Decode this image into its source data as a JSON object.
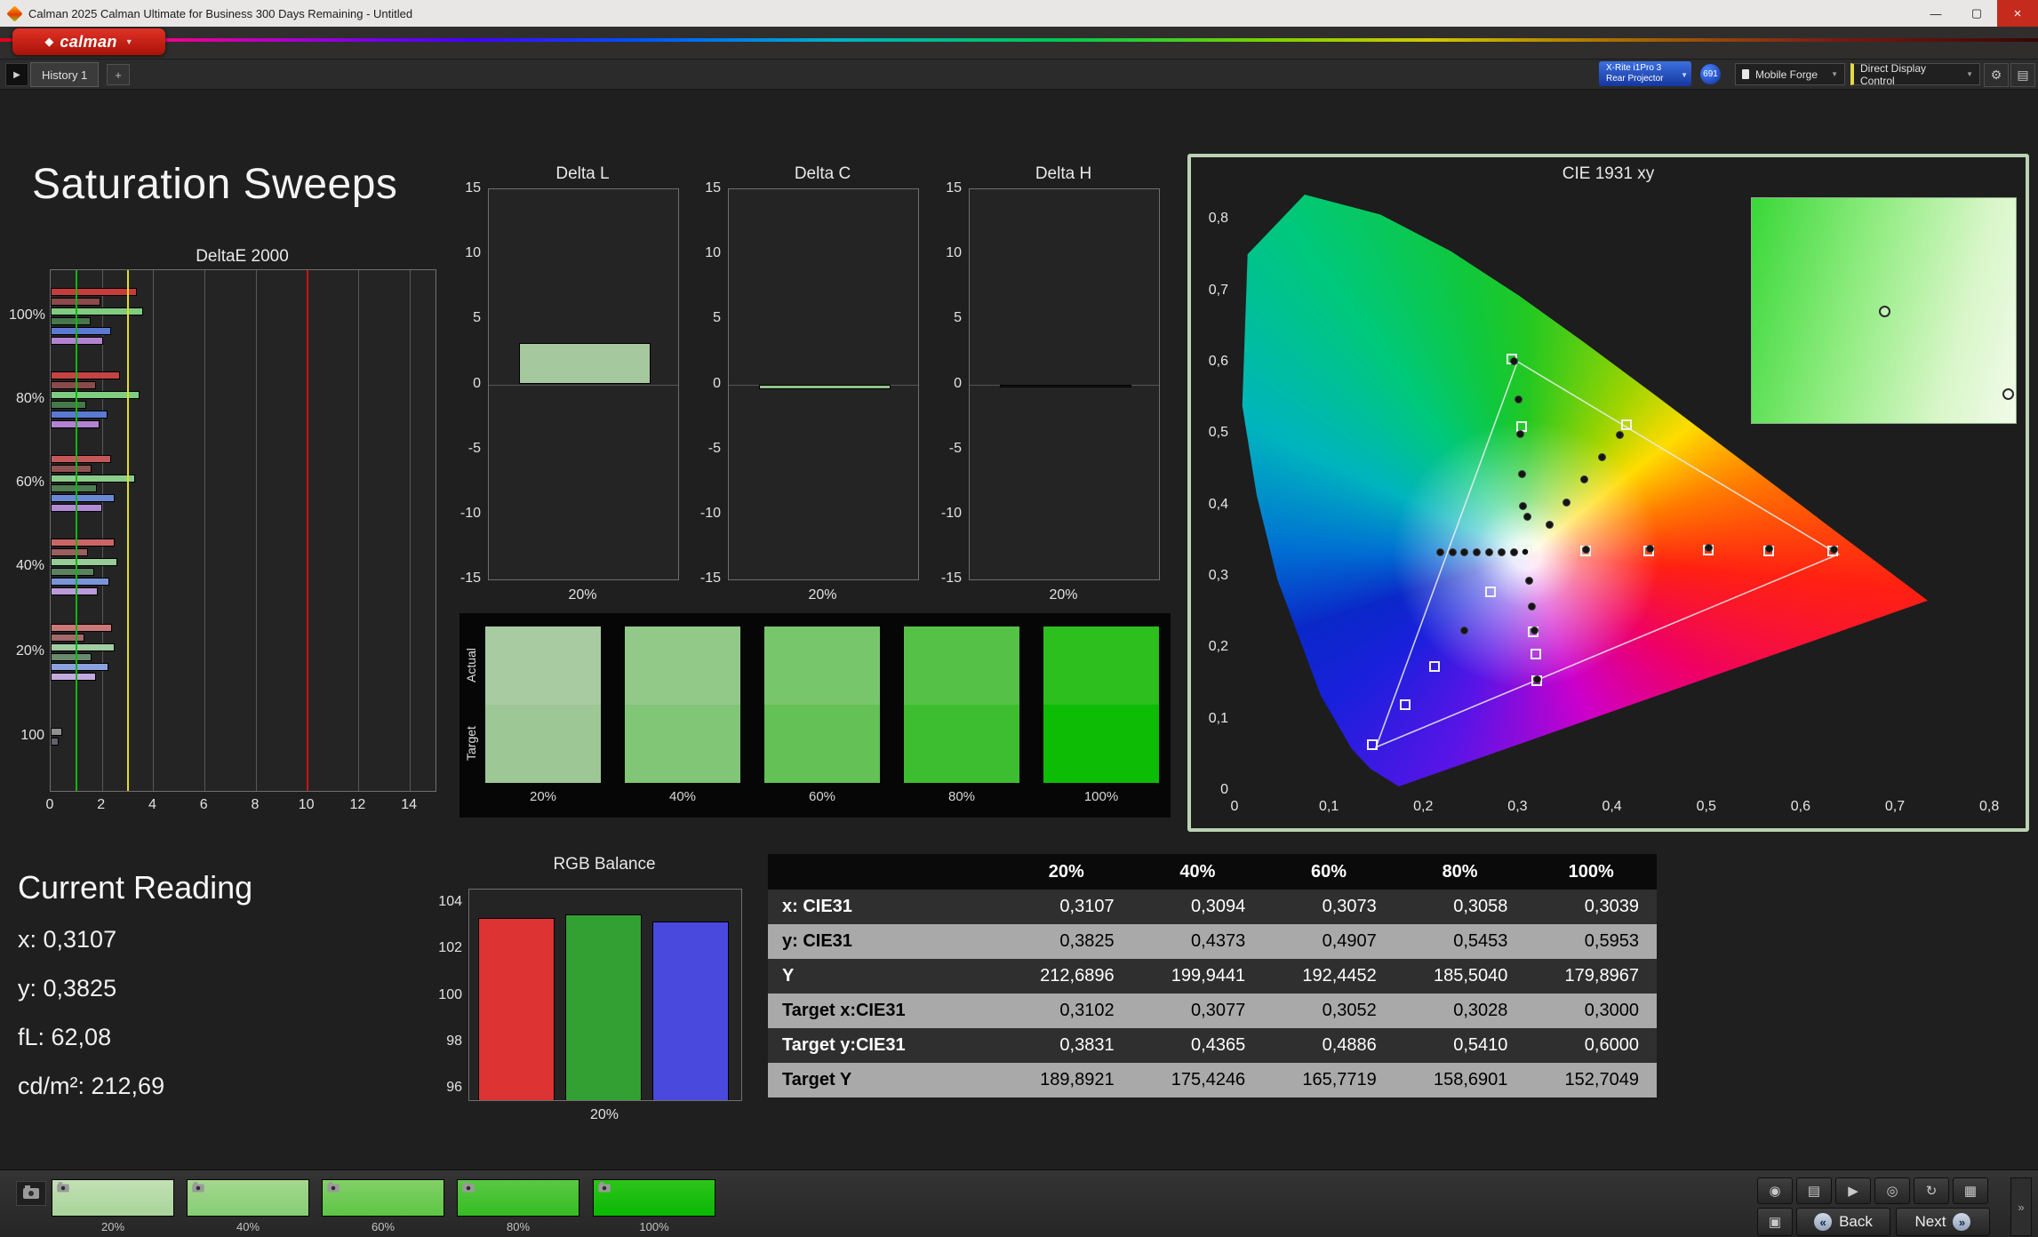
{
  "window": {
    "title": "Calman 2025 Calman Ultimate for Business 300 Days Remaining  - Untitled"
  },
  "brand": {
    "logo_text": "calman"
  },
  "icons": {
    "app": "◆",
    "logo_mark": "◆",
    "caret_down": "▼",
    "minimize": "—",
    "maximize": "▢",
    "close": "×",
    "history_arrow": "▶",
    "add": "+",
    "gear": "⚙",
    "layout": "▤",
    "monitor": "▣",
    "back_chevrons": "«",
    "next_chevrons": "»",
    "side_chevron": "»"
  },
  "toolbar": {
    "history_tab": "History 1",
    "meter": {
      "line1": "X-Rite i1Pro 3",
      "line2": "Rear Projector"
    },
    "badge": "691",
    "source": "Mobile Forge",
    "display_control": "Direct Display Control"
  },
  "page_title": "Saturation Sweeps",
  "current_reading": {
    "title": "Current Reading",
    "lines": [
      "x: 0,3107",
      "y: 0,3825",
      "fL: 62,08",
      "cd/m²: 212,69"
    ]
  },
  "chart_data": [
    {
      "id": "deltae2000",
      "type": "bar",
      "orientation": "horizontal",
      "title": "DeltaE 2000",
      "xlim": [
        0,
        15
      ],
      "x_ticks": [
        0,
        2,
        4,
        6,
        8,
        10,
        12,
        14
      ],
      "reference_lines": [
        {
          "value": 1,
          "color": "#12b412"
        },
        {
          "value": 3,
          "color": "#e0e020"
        },
        {
          "value": 10,
          "color": "#cc1414"
        }
      ],
      "groups": [
        {
          "label": "100%",
          "bars": [
            {
              "v": 3.35,
              "c": "#c43c3c"
            },
            {
              "v": 1.95,
              "c": "#8a4a4a"
            },
            {
              "v": 3.6,
              "c": "#80cc80"
            },
            {
              "v": 1.55,
              "c": "#46784a"
            },
            {
              "v": 2.35,
              "c": "#5a7ad2"
            },
            {
              "v": 2.05,
              "c": "#b482d2"
            }
          ]
        },
        {
          "label": "80%",
          "bars": [
            {
              "v": 2.7,
              "c": "#c44444"
            },
            {
              "v": 1.75,
              "c": "#8a4a4a"
            },
            {
              "v": 3.45,
              "c": "#80cc80"
            },
            {
              "v": 1.4,
              "c": "#46784a"
            },
            {
              "v": 2.2,
              "c": "#5a7ad2"
            },
            {
              "v": 1.9,
              "c": "#b482d2"
            }
          ]
        },
        {
          "label": "60%",
          "bars": [
            {
              "v": 2.35,
              "c": "#c45858"
            },
            {
              "v": 1.6,
              "c": "#925252"
            },
            {
              "v": 3.3,
              "c": "#8acc8a"
            },
            {
              "v": 1.8,
              "c": "#4e7e52"
            },
            {
              "v": 2.5,
              "c": "#6a88d6"
            },
            {
              "v": 2.0,
              "c": "#b48ad6"
            }
          ]
        },
        {
          "label": "40%",
          "bars": [
            {
              "v": 2.5,
              "c": "#cc6666"
            },
            {
              "v": 1.45,
              "c": "#9a5e5e"
            },
            {
              "v": 2.6,
              "c": "#96cc96"
            },
            {
              "v": 1.7,
              "c": "#5a825e"
            },
            {
              "v": 2.3,
              "c": "#7a94da"
            },
            {
              "v": 1.85,
              "c": "#bc9ada"
            }
          ]
        },
        {
          "label": "20%",
          "bars": [
            {
              "v": 2.4,
              "c": "#cc7878"
            },
            {
              "v": 1.3,
              "c": "#a26a6a"
            },
            {
              "v": 2.5,
              "c": "#a2cca2"
            },
            {
              "v": 1.6,
              "c": "#6a8a6e"
            },
            {
              "v": 2.25,
              "c": "#8aa2de"
            },
            {
              "v": 1.75,
              "c": "#c2aade"
            }
          ]
        },
        {
          "label": "100",
          "bars": [
            {
              "v": 0.45,
              "c": "#909090"
            },
            {
              "v": 0.3,
              "c": "#606070"
            }
          ]
        }
      ]
    },
    {
      "id": "delta_l",
      "type": "bar",
      "title": "Delta L",
      "ylim": [
        -15,
        15
      ],
      "y_ticks": [
        15,
        10,
        5,
        0,
        -5,
        -10,
        -15
      ],
      "categories": [
        "20%"
      ],
      "values": [
        3.15
      ],
      "bar_color": "#a6c89e"
    },
    {
      "id": "delta_c",
      "type": "bar",
      "title": "Delta C",
      "ylim": [
        -15,
        15
      ],
      "y_ticks": [
        15,
        10,
        5,
        0,
        -5,
        -10,
        -15
      ],
      "categories": [
        "20%"
      ],
      "values": [
        -0.4
      ],
      "bar_color": "#8fc287"
    },
    {
      "id": "delta_h",
      "type": "bar",
      "title": "Delta H",
      "ylim": [
        -15,
        15
      ],
      "y_ticks": [
        15,
        10,
        5,
        0,
        -5,
        -10,
        -15
      ],
      "categories": [
        "20%"
      ],
      "values": [
        -0.15
      ],
      "bar_color": "#161616"
    },
    {
      "id": "rgb_balance",
      "type": "bar",
      "title": "RGB Balance",
      "ylim": [
        95.4,
        104.6
      ],
      "y_ticks": [
        104,
        102,
        100,
        98,
        96
      ],
      "categories": [
        "20%"
      ],
      "series": [
        {
          "name": "Red",
          "value": 103.35,
          "color": "#dd3333"
        },
        {
          "name": "Green",
          "value": 103.5,
          "color": "#33a033"
        },
        {
          "name": "Blue",
          "value": 103.2,
          "color": "#4949dd"
        }
      ]
    },
    {
      "id": "cie1931",
      "type": "scatter",
      "title": "CIE 1931 xy",
      "xlim": [
        0,
        0.8
      ],
      "ylim": [
        0,
        0.8
      ],
      "x_tick_labels": [
        "0",
        "0,1",
        "0,2",
        "0,3",
        "0,4",
        "0,5",
        "0,6",
        "0,7",
        "0,8"
      ],
      "y_tick_labels": [
        "0",
        "0,1",
        "0,2",
        "0,3",
        "0,4",
        "0,5",
        "0,6",
        "0,7",
        "0,8"
      ],
      "gamut_triangle": [
        [
          0.64,
          0.33
        ],
        [
          0.3,
          0.6
        ],
        [
          0.15,
          0.06
        ]
      ],
      "points": [
        {
          "x": 0.294,
          "y": 0.604,
          "m": "square"
        },
        {
          "x": 0.296,
          "y": 0.6,
          "m": "circle"
        },
        {
          "x": 0.301,
          "y": 0.547,
          "m": "circle"
        },
        {
          "x": 0.304,
          "y": 0.509,
          "m": "square"
        },
        {
          "x": 0.303,
          "y": 0.498,
          "m": "circle"
        },
        {
          "x": 0.305,
          "y": 0.442,
          "m": "circle"
        },
        {
          "x": 0.306,
          "y": 0.398,
          "m": "circle"
        },
        {
          "x": 0.334,
          "y": 0.372,
          "m": "circle"
        },
        {
          "x": 0.352,
          "y": 0.403,
          "m": "circle"
        },
        {
          "x": 0.371,
          "y": 0.435,
          "m": "circle"
        },
        {
          "x": 0.39,
          "y": 0.466,
          "m": "circle"
        },
        {
          "x": 0.408,
          "y": 0.497,
          "m": "circle"
        },
        {
          "x": 0.415,
          "y": 0.511,
          "m": "square"
        },
        {
          "x": 0.372,
          "y": 0.335,
          "m": "square"
        },
        {
          "x": 0.439,
          "y": 0.335,
          "m": "square"
        },
        {
          "x": 0.502,
          "y": 0.336,
          "m": "square"
        },
        {
          "x": 0.566,
          "y": 0.335,
          "m": "square"
        },
        {
          "x": 0.634,
          "y": 0.335,
          "m": "square"
        },
        {
          "x": 0.373,
          "y": 0.337,
          "m": "circle"
        },
        {
          "x": 0.44,
          "y": 0.338,
          "m": "circle"
        },
        {
          "x": 0.503,
          "y": 0.339,
          "m": "circle"
        },
        {
          "x": 0.567,
          "y": 0.338,
          "m": "circle"
        },
        {
          "x": 0.635,
          "y": 0.337,
          "m": "circle"
        },
        {
          "x": 0.218,
          "y": 0.333,
          "m": "circle"
        },
        {
          "x": 0.231,
          "y": 0.333,
          "m": "circle"
        },
        {
          "x": 0.244,
          "y": 0.333,
          "m": "circle"
        },
        {
          "x": 0.257,
          "y": 0.333,
          "m": "circle"
        },
        {
          "x": 0.27,
          "y": 0.333,
          "m": "circle"
        },
        {
          "x": 0.283,
          "y": 0.333,
          "m": "circle"
        },
        {
          "x": 0.296,
          "y": 0.333,
          "m": "circle"
        },
        {
          "x": 0.3107,
          "y": 0.3825,
          "m": "circle"
        },
        {
          "x": 0.308,
          "y": 0.333,
          "m": "boxed"
        },
        {
          "x": 0.312,
          "y": 0.293,
          "m": "circle"
        },
        {
          "x": 0.315,
          "y": 0.257,
          "m": "circle"
        },
        {
          "x": 0.317,
          "y": 0.222,
          "m": "square"
        },
        {
          "x": 0.318,
          "y": 0.223,
          "m": "circle"
        },
        {
          "x": 0.319,
          "y": 0.191,
          "m": "square"
        },
        {
          "x": 0.32,
          "y": 0.153,
          "m": "square"
        },
        {
          "x": 0.321,
          "y": 0.155,
          "m": "circle"
        },
        {
          "x": 0.271,
          "y": 0.277,
          "m": "square"
        },
        {
          "x": 0.244,
          "y": 0.224,
          "m": "circle"
        },
        {
          "x": 0.212,
          "y": 0.173,
          "m": "square"
        },
        {
          "x": 0.181,
          "y": 0.12,
          "m": "square"
        },
        {
          "x": 0.146,
          "y": 0.064,
          "m": "square"
        }
      ],
      "inset_points": [
        {
          "fx": 0.5,
          "fy": 0.5
        },
        {
          "fx": 0.97,
          "fy": 0.87
        }
      ]
    }
  ],
  "swatches": {
    "row_labels": [
      "Actual",
      "Target"
    ],
    "items": [
      {
        "label": "20%",
        "actual": "#a9cba2",
        "target": "#9dc795"
      },
      {
        "label": "40%",
        "actual": "#92c989",
        "target": "#81c577"
      },
      {
        "label": "60%",
        "actual": "#78c66c",
        "target": "#63c156"
      },
      {
        "label": "80%",
        "actual": "#55c247",
        "target": "#3dbe30"
      },
      {
        "label": "100%",
        "actual": "#2cbf1e",
        "target": "#0dbc04"
      }
    ]
  },
  "table": {
    "columns": [
      "",
      "20%",
      "40%",
      "60%",
      "80%",
      "100%"
    ],
    "rows": [
      {
        "label": "x: CIE31",
        "values": [
          "0,3107",
          "0,3094",
          "0,3073",
          "0,3058",
          "0,3039"
        ]
      },
      {
        "label": "y: CIE31",
        "values": [
          "0,3825",
          "0,4373",
          "0,4907",
          "0,5453",
          "0,5953"
        ]
      },
      {
        "label": "Y",
        "values": [
          "212,6896",
          "199,9441",
          "192,4452",
          "185,5040",
          "179,8967"
        ]
      },
      {
        "label": "Target x:CIE31",
        "values": [
          "0,3102",
          "0,3077",
          "0,3052",
          "0,3028",
          "0,3000"
        ]
      },
      {
        "label": "Target y:CIE31",
        "values": [
          "0,3831",
          "0,4365",
          "0,4886",
          "0,5410",
          "0,6000"
        ]
      },
      {
        "label": "Target Y",
        "values": [
          "189,8921",
          "175,4246",
          "165,7719",
          "158,6901",
          "152,7049"
        ]
      }
    ]
  },
  "bottom_bar": {
    "swatch_buttons": [
      {
        "label": "20%",
        "c1": "#c2e0b4",
        "c2": "#a8d49a"
      },
      {
        "label": "40%",
        "c1": "#a4d88e",
        "c2": "#86cc74"
      },
      {
        "label": "60%",
        "c1": "#82d066",
        "c2": "#5ec646"
      },
      {
        "label": "80%",
        "c1": "#5cc844",
        "c2": "#34bc24"
      },
      {
        "label": "100%",
        "c1": "#2ec41c",
        "c2": "#0ab802"
      }
    ],
    "tools": [
      {
        "name": "camera-icon",
        "glyph": "◉"
      },
      {
        "name": "printer-icon",
        "glyph": "▤"
      },
      {
        "name": "play-icon",
        "glyph": "▶"
      },
      {
        "name": "search-icon",
        "glyph": "◎"
      },
      {
        "name": "refresh-icon",
        "glyph": "↻"
      },
      {
        "name": "grid-icon",
        "glyph": "▦"
      }
    ],
    "nav": {
      "back": "Back",
      "next": "Next"
    }
  }
}
